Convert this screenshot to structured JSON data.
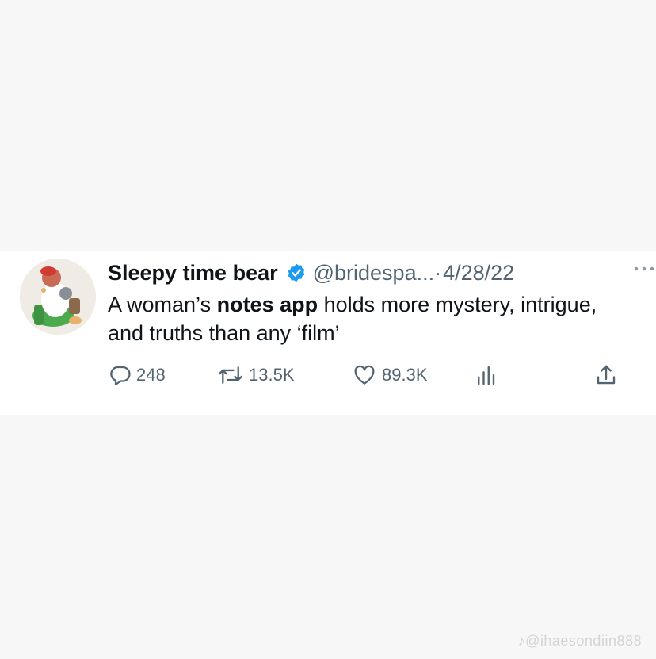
{
  "tweet": {
    "display_name": "Sleepy time bear",
    "handle": "@bridespa...",
    "separator": "·",
    "date": "4/28/22",
    "text_before": "A woman’s ",
    "text_bold": "notes app",
    "text_after": " holds more mystery, intrigue, and truths than any ‘film’",
    "icons": {
      "verified": "verified-badge-icon",
      "more": "more-options-icon"
    }
  },
  "actions": {
    "reply_count": "248",
    "retweet_count": "13.5K",
    "like_count": "89.3K",
    "icons": {
      "reply": "reply-icon",
      "retweet": "retweet-icon",
      "like": "heart-icon",
      "views": "views-icon",
      "share": "share-icon"
    }
  },
  "watermark": {
    "text": "♪@ihaesondiin888"
  },
  "colors": {
    "background": "#f7f7f7",
    "card": "#ffffff",
    "text_primary": "#0f1419",
    "text_secondary": "#536471",
    "verified_blue": "#1d9bf0"
  }
}
